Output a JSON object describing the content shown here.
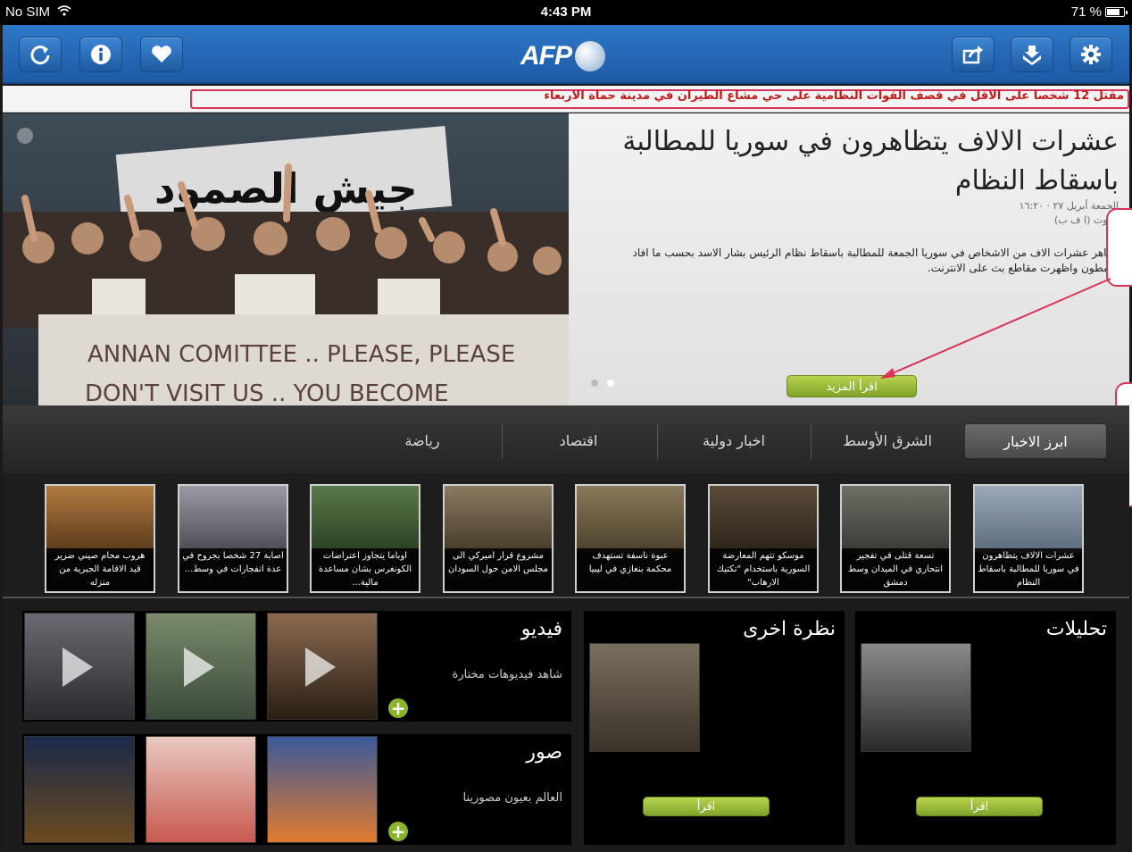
{
  "status_bar": {
    "carrier": "No SIM",
    "time": "4:43 PM",
    "battery": "71 %"
  },
  "toolbar": {
    "logo_text": "AFP",
    "left_buttons": [
      "refresh-icon",
      "info-icon",
      "heart-icon"
    ],
    "right_buttons": [
      "share-icon",
      "download-icon",
      "gear-icon"
    ]
  },
  "ticker": {
    "text": "مقتل 12 شخصا على الاقل في قصف القوات النظامية على حي مشاع الطيران في مدينة حماة الاربعاء"
  },
  "hero": {
    "title": "عشرات الالاف يتظاهرون في سوريا للمطالبة باسقاط النظام",
    "date": "الجمعة أبريل ٢٧ · ١٦:٢٠",
    "source": "بيروت (ا ف ب)",
    "body": "تظاهر عشرات الاف من الاشخاص في سوريا الجمعة للمطالبة باسقاط نظام الرئيس بشار الاسد بحسب ما افاد ناشطون واظهرت مقاطع بث على الانترنت.",
    "read_more": "اقرأ المزيد",
    "photo_banner_1": "ANNAN COMITTEE .. PLEASE, PLEASE",
    "photo_banner_2": "DON'T VISIT US .. YOU BECOME",
    "photo_banner_arabic": "جيش الصمود"
  },
  "tabs": [
    {
      "label": "ابرز الاخبار",
      "active": true
    },
    {
      "label": "الشرق الأوسط",
      "active": false
    },
    {
      "label": "اخبار دولية",
      "active": false
    },
    {
      "label": "اقتصاد",
      "active": false
    },
    {
      "label": "رياضة",
      "active": false
    }
  ],
  "thumbnails": [
    {
      "caption": "عشرات الالاف يتظاهرون في سوريا للمطالبة باسقاط النظام",
      "color": "#7a8aa0"
    },
    {
      "caption": "تسعة قتلى في تفجير انتحاري في الميدان وسط دمشق",
      "color": "#5a5a52"
    },
    {
      "caption": "موسكو تتهم المعارضة السورية باستخدام \"تكتيك الارهاب\"",
      "color": "#4a3a2a"
    },
    {
      "caption": "عبوة ناسفة تستهدف محكمة بنغازي في ليبيا",
      "color": "#6b5e45"
    },
    {
      "caption": "مشروع قرار اميركي الى مجلس الامن حول السودان",
      "color": "#6e5e48"
    },
    {
      "caption": "اوباما يتجاوز اعتراضات الكونغرس بشان مساعدة مالية...",
      "color": "#3e5a38"
    },
    {
      "caption": "اصابة 27 شخصا بجروح في عدة انفجارات في وسط...",
      "color": "#6a6a70"
    },
    {
      "caption": "هروب محام صيني ضرير قيد الاقامة الجبرية من منزله",
      "color": "#8a5a30"
    }
  ],
  "sections": {
    "analysis": {
      "title": "تحليلات",
      "button": "اقرأ"
    },
    "other_view": {
      "title": "نظرة اخرى",
      "button": "اقرأ"
    },
    "video": {
      "title": "فيديو",
      "subtitle": "شاهد فيديوهات مختارة"
    },
    "photos": {
      "title": "صور",
      "subtitle": "العالم بعيون مصورينا"
    }
  },
  "colors": {
    "toolbar": "#2266b5",
    "accent_green": "#8ab52a",
    "ticker_text": "#c01b1b",
    "annotation": "#d93357"
  }
}
